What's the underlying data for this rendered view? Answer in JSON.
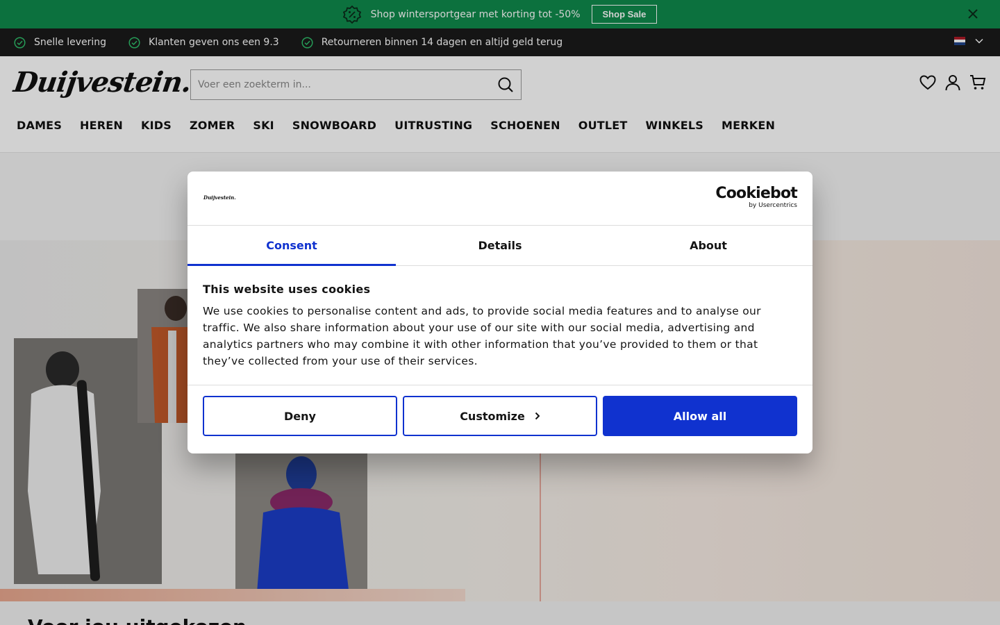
{
  "promo": {
    "text": "Shop wintersportgear met korting tot -50%",
    "button": "Shop Sale"
  },
  "usp": {
    "items": [
      "Snelle levering",
      "Klanten geven ons een 9.3",
      "Retourneren binnen 14 dagen en altijd geld terug"
    ]
  },
  "header": {
    "logo": "Duijvestein.",
    "search_placeholder": "Voer een zoekterm in...",
    "nav": [
      "DAMES",
      "HEREN",
      "KIDS",
      "ZOMER",
      "SKI",
      "SNOWBOARD",
      "UITRUSTING",
      "SCHOENEN",
      "OUTLET",
      "WINKELS",
      "MERKEN"
    ]
  },
  "page": {
    "section_title": "Voor jou uitgekozen"
  },
  "cookie": {
    "logo": "Duijvestein.",
    "brand": "Cookiebot",
    "brand_sub": "by Usercentrics",
    "tabs": [
      "Consent",
      "Details",
      "About"
    ],
    "title": "This website uses cookies",
    "body": "We use cookies to personalise content and ads, to provide social media features and to analyse our traffic. We also share information about your use of our site with our social media, advertising and analytics partners who may combine it with other information that you’ve provided to them or that they’ve collected from your use of their services.",
    "deny": "Deny",
    "customize": "Customize",
    "allow": "Allow all"
  },
  "colors": {
    "promo_bg": "#0f8a4c",
    "usp_bg": "#1a1a1a",
    "accent": "#1032cf",
    "check": "#2fbf6b"
  },
  "icons": {
    "promo": "percent-badge-icon",
    "close": "close-icon",
    "usp": "check-circle-icon",
    "search": "search-icon",
    "wishlist": "heart-icon",
    "account": "user-icon",
    "cart": "cart-icon",
    "customize": "chevron-right-icon",
    "language": "chevron-down-icon"
  }
}
